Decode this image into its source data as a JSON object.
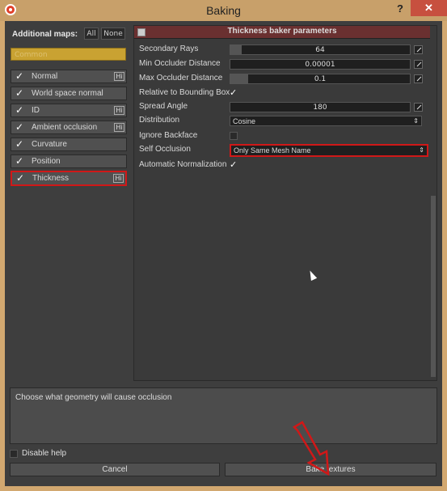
{
  "window": {
    "title": "Baking",
    "help_glyph": "?",
    "close_glyph": "✕"
  },
  "left": {
    "title": "Additional maps:",
    "all_label": "All",
    "none_label": "None",
    "common_label": "Common",
    "maps": [
      {
        "label": "Normal",
        "checked": true,
        "hi": true
      },
      {
        "label": "World space normal",
        "checked": true,
        "hi": false
      },
      {
        "label": "ID",
        "checked": true,
        "hi": true
      },
      {
        "label": "Ambient occlusion",
        "checked": true,
        "hi": true
      },
      {
        "label": "Curvature",
        "checked": true,
        "hi": false
      },
      {
        "label": "Position",
        "checked": true,
        "hi": false
      },
      {
        "label": "Thickness",
        "checked": true,
        "hi": true
      }
    ],
    "hi_label": "Hi",
    "check_glyph": "✓"
  },
  "params": {
    "header": "Thickness baker parameters",
    "secondary_rays": {
      "label": "Secondary Rays",
      "value": "64"
    },
    "min_occluder": {
      "label": "Min Occluder Distance",
      "value": "0.00001"
    },
    "max_occluder": {
      "label": "Max Occluder Distance",
      "value": "0.1"
    },
    "relative_bbox": {
      "label": "Relative to Bounding Box",
      "checked": true
    },
    "spread_angle": {
      "label": "Spread Angle",
      "value": "180"
    },
    "distribution": {
      "label": "Distribution",
      "value": "Cosine"
    },
    "ignore_backface": {
      "label": "Ignore Backface",
      "checked": false
    },
    "self_occlusion": {
      "label": "Self Occlusion",
      "value": "Only Same Mesh Name"
    },
    "auto_normalization": {
      "label": "Automatic Normalization",
      "checked": true
    },
    "select_arrow": "⇕"
  },
  "help": {
    "text": "Choose what geometry will cause occlusion"
  },
  "footer": {
    "disable_help": "Disable help",
    "cancel": "Cancel",
    "bake": "Bake textures"
  }
}
